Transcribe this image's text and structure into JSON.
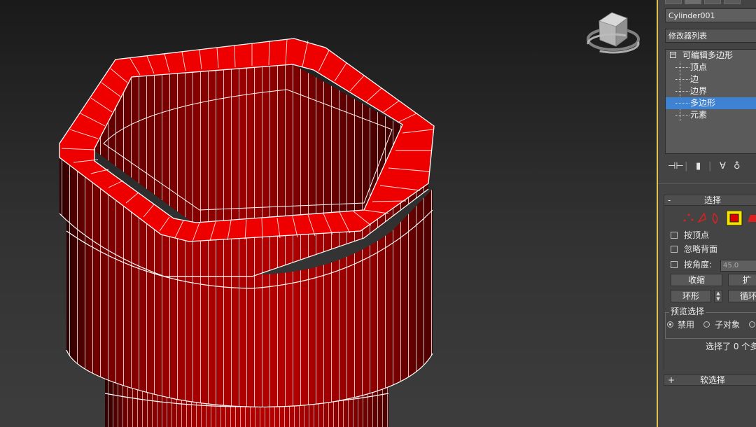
{
  "object_name": "Cylinder001",
  "modifier_list_label": "修改器列表",
  "stack": {
    "root": "可编辑多边形",
    "items": [
      "顶点",
      "边",
      "边界",
      "多边形",
      "元素"
    ],
    "selected": "多边形"
  },
  "selection_rollout": {
    "title": "选择",
    "collapse_glyph": "-",
    "options": {
      "by_vertex": "按顶点",
      "ignore_backfacing": "忽略背面",
      "by_angle": "按角度:",
      "angle_value": "45.0"
    },
    "buttons": {
      "shrink": "收缩",
      "grow": "扩",
      "ring": "环形",
      "loop": "循环"
    },
    "preview": {
      "title": "预览选择",
      "disabled": "禁用",
      "subobject": "子对象"
    },
    "status": "选择了 0 个多"
  },
  "soft_selection": {
    "title": "软选择",
    "expand_glyph": "+"
  },
  "colors": {
    "poly_selected": "#ff0000",
    "viewport_bg": "#2b2b2b",
    "highlight": "#3e82d4",
    "accent": "#e0c34a"
  },
  "icons": [
    "viewcube-icon",
    "pin-stack-icon",
    "show-end-result-icon",
    "make-unique-icon",
    "remove-modifier-icon",
    "configure-icon",
    "vertex-mode-icon",
    "edge-mode-icon",
    "border-mode-icon",
    "polygon-mode-icon",
    "element-mode-icon"
  ]
}
